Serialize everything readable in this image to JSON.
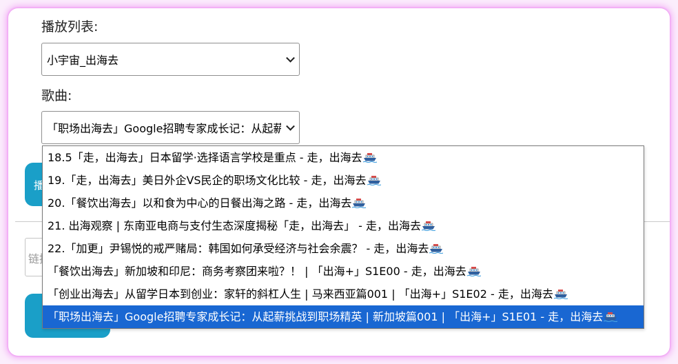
{
  "playlist": {
    "label": "播放列表:",
    "selected": "小宇宙_出海去"
  },
  "song": {
    "label": "歌曲:",
    "selected": "「职场出海去」Google招聘专家成长记：从起薪"
  },
  "hidden_button_left": "播",
  "link_input_placeholder": "链接",
  "dropdown_options": [
    {
      "text": "18.5「走，出海去」日本留学·选择语言学校是重点 - 走，出海去",
      "selected": false
    },
    {
      "text": "19.「走，出海去」美日外企VS民企的职场文化比较 - 走，出海去",
      "selected": false
    },
    {
      "text": "20.「餐饮出海去」以和食为中心的日餐出海之路 - 走，出海去",
      "selected": false
    },
    {
      "text": "21. 出海观察 | 东南亚电商与支付生态深度揭秘「走，出海去」 - 走，出海去",
      "selected": false
    },
    {
      "text": "22.「加更」尹锡悦的戒严赌局：韩国如何承受经济与社会余震？ - 走，出海去",
      "selected": false
    },
    {
      "text": "「餐饮出海去」新加坡和印尼：商务考察团来啦？！ | 「出海+」S1E00 - 走，出海去",
      "selected": false
    },
    {
      "text": "「创业出海去」从留学日本到创业：家轩的斜杠人生 | 马来西亚篇001 | 「出海+」S1E02 - 走，出海去",
      "selected": false
    },
    {
      "text": "「职场出海去」Google招聘专家成长记：从起薪挑战到职场精英 | 新加坡篇001 | 「出海+」S1E01 - 走，出海去",
      "selected": true
    }
  ],
  "icons": {
    "option_suffix_icon": "ship-icon"
  },
  "colors": {
    "accent": "#1a9fc8",
    "selected_option": "#1967d2",
    "glow": "#f2a8f5"
  }
}
